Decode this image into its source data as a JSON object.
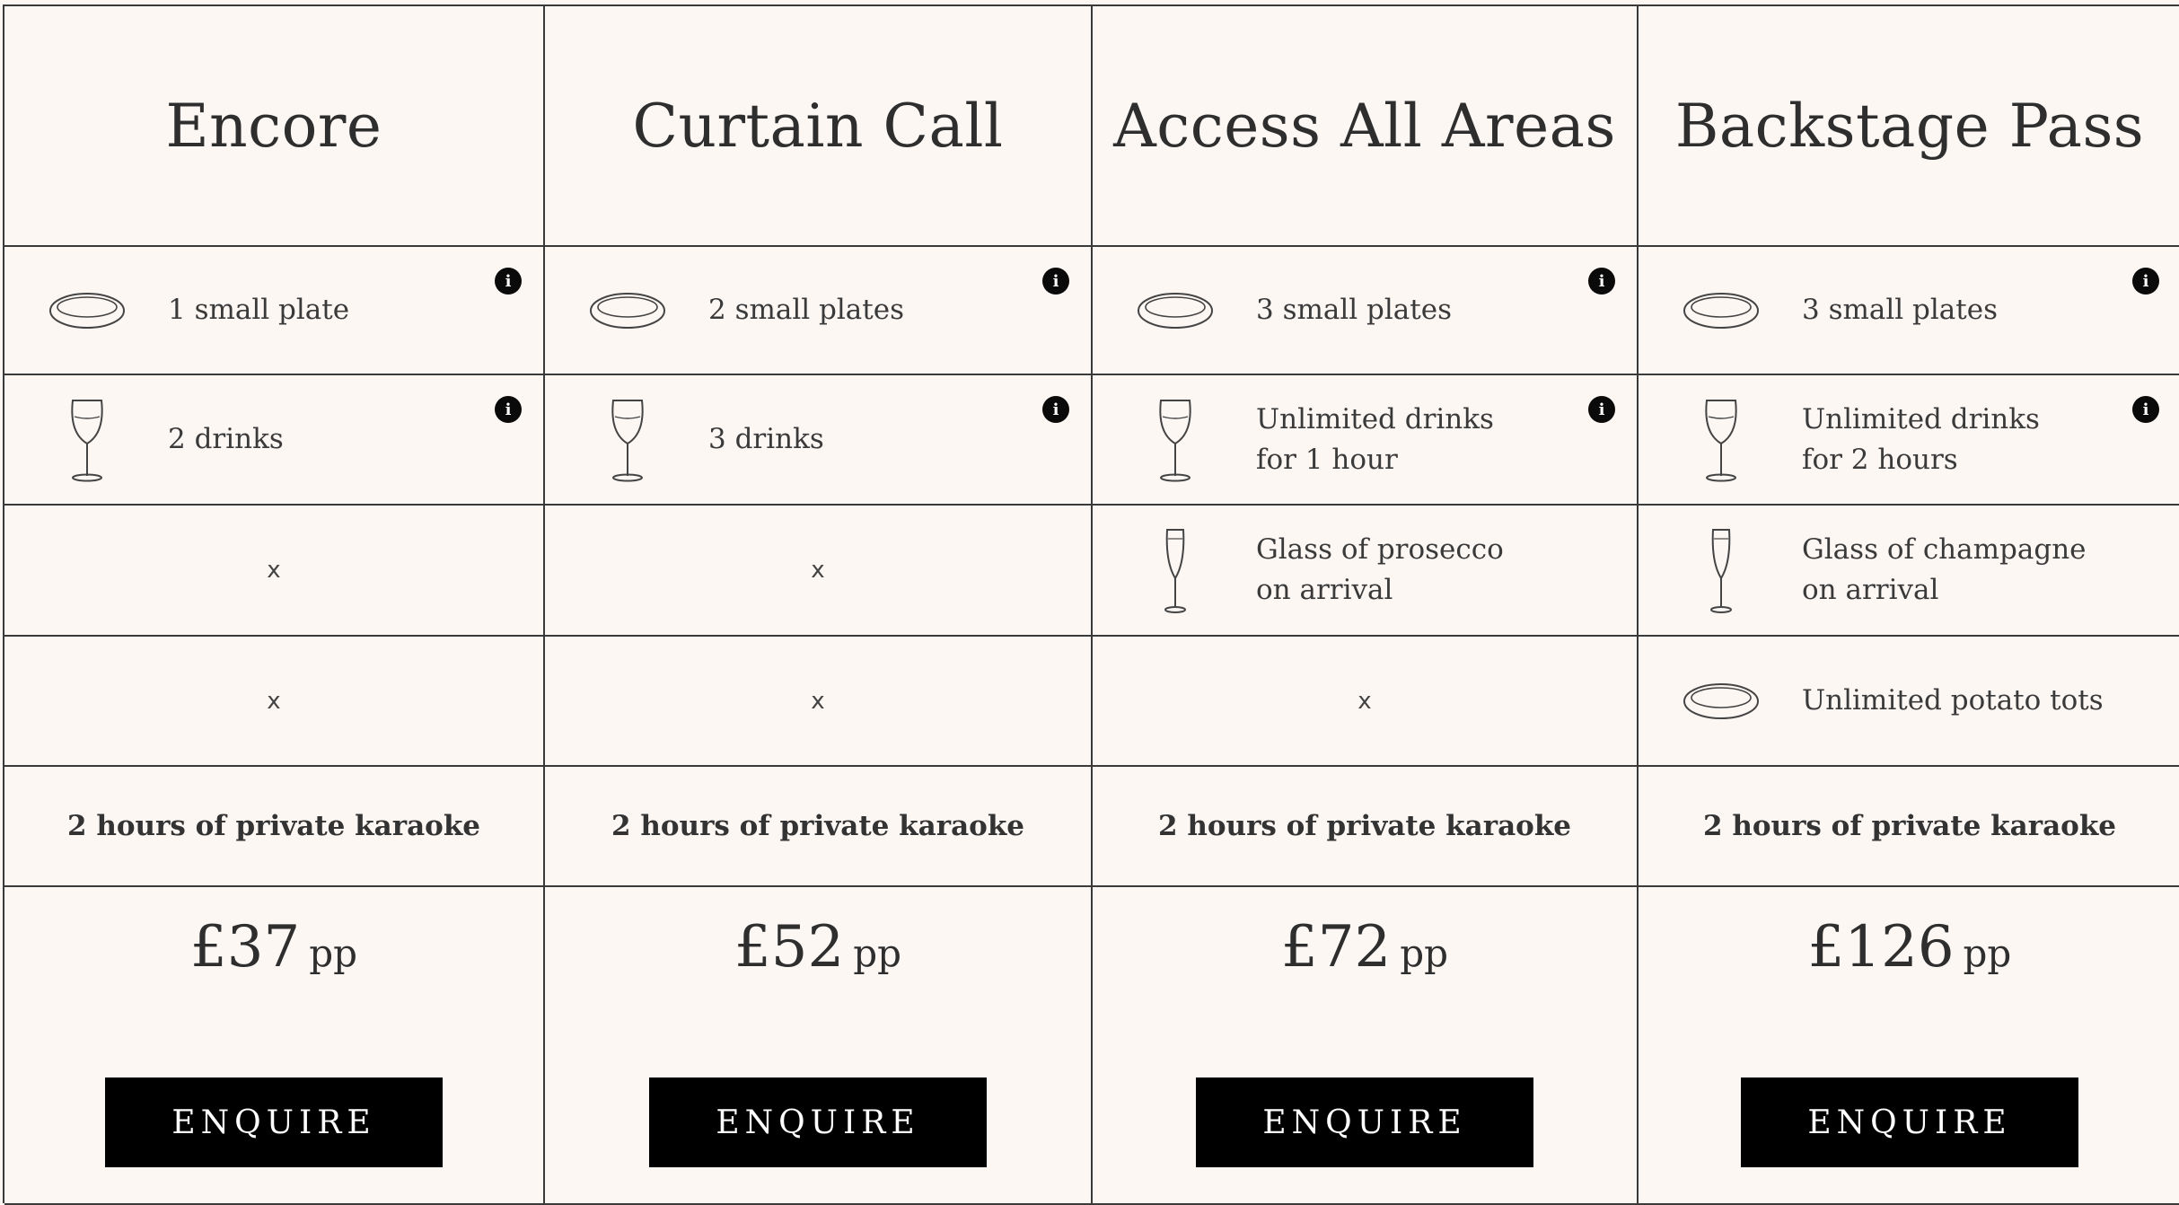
{
  "packages": [
    {
      "title": "Encore",
      "food": "1 small plate",
      "drinks": "2 drinks",
      "arrival": "x",
      "extra": "x",
      "karaoke": "2 hours of private karaoke",
      "price": "£37",
      "price_unit": "pp",
      "cta": "ENQUIRE"
    },
    {
      "title": "Curtain Call",
      "food": "2 small plates",
      "drinks": "3 drinks",
      "arrival": "x",
      "extra": "x",
      "karaoke": "2 hours of private karaoke",
      "price": "£52",
      "price_unit": "pp",
      "cta": "ENQUIRE"
    },
    {
      "title": "Access All Areas",
      "food": "3 small plates",
      "drinks": "Unlimited drinks\nfor 1 hour",
      "arrival": "Glass of prosecco\non arrival",
      "extra": "x",
      "karaoke": "2 hours of private karaoke",
      "price": "£72",
      "price_unit": "pp",
      "cta": "ENQUIRE"
    },
    {
      "title": "Backstage Pass",
      "food": "3 small plates",
      "drinks": "Unlimited drinks\nfor 2 hours",
      "arrival": "Glass of champagne\non arrival",
      "extra": "Unlimited potato tots",
      "karaoke": "2 hours of private karaoke",
      "price": "£126",
      "price_unit": "pp",
      "cta": "ENQUIRE"
    }
  ],
  "info_glyph": "i",
  "icons": {
    "food": "plate-icon",
    "drinks": "wine-glass-icon",
    "arrival": "champagne-flute-icon",
    "extra": "plate-icon",
    "info": "info-icon"
  },
  "colors": {
    "background": "#fdf7f4",
    "grid_line": "#3a3a3a",
    "text": "#333333",
    "button": "#000000",
    "button_text": "#ffffff"
  }
}
